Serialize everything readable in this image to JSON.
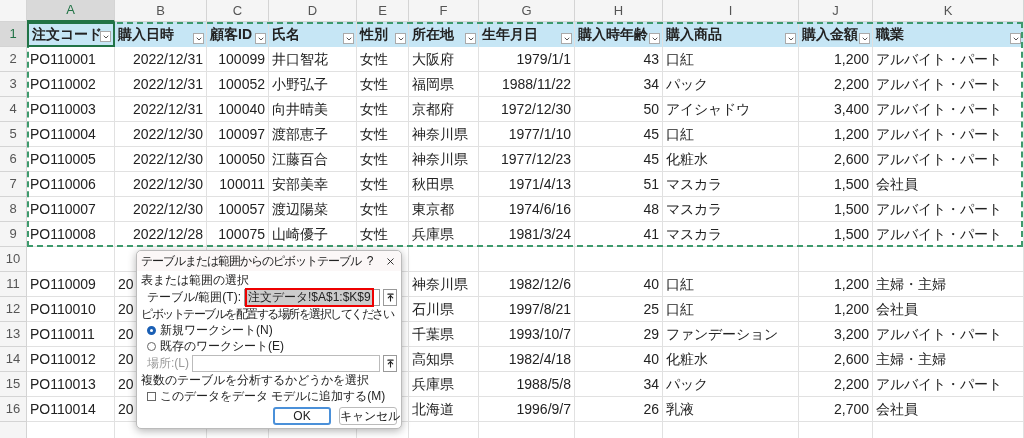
{
  "columns": [
    {
      "letter": "A",
      "selected": true
    },
    {
      "letter": "B",
      "selected": false
    },
    {
      "letter": "C",
      "selected": false
    },
    {
      "letter": "D",
      "selected": false
    },
    {
      "letter": "E",
      "selected": false
    },
    {
      "letter": "F",
      "selected": false
    },
    {
      "letter": "G",
      "selected": false
    },
    {
      "letter": "H",
      "selected": false
    },
    {
      "letter": "I",
      "selected": false
    },
    {
      "letter": "J",
      "selected": false
    },
    {
      "letter": "K",
      "selected": false
    }
  ],
  "copy_marquee": true,
  "header_row": {
    "number": "1",
    "selected": true,
    "cells": [
      {
        "text": "注文コード",
        "selected": true
      },
      {
        "text": "購入日時",
        "selected": false
      },
      {
        "text": "顧客ID",
        "selected": false
      },
      {
        "text": "氏名",
        "selected": false
      },
      {
        "text": "性別",
        "selected": false
      },
      {
        "text": "所在地",
        "selected": false
      },
      {
        "text": "生年月日",
        "selected": false
      },
      {
        "text": "購入時年齢",
        "selected": false
      },
      {
        "text": "購入商品",
        "selected": false
      },
      {
        "text": "購入金額",
        "selected": false
      },
      {
        "text": "職業",
        "selected": false
      }
    ]
  },
  "rows": [
    {
      "number": "2",
      "kind": "full",
      "cells": [
        "PO110001",
        "2022/12/31",
        "100099",
        "井口智花",
        "女性",
        "大阪府",
        "1979/1/1",
        "43",
        "口紅",
        "1,200",
        "アルバイト・パート"
      ]
    },
    {
      "number": "3",
      "kind": "full",
      "cells": [
        "PO110002",
        "2022/12/31",
        "100052",
        "小野弘子",
        "女性",
        "福岡県",
        "1988/11/22",
        "34",
        "パック",
        "2,200",
        "アルバイト・パート"
      ]
    },
    {
      "number": "4",
      "kind": "full",
      "cells": [
        "PO110003",
        "2022/12/31",
        "100040",
        "向井晴美",
        "女性",
        "京都府",
        "1972/12/30",
        "50",
        "アイシャドウ",
        "3,400",
        "アルバイト・パート"
      ]
    },
    {
      "number": "5",
      "kind": "full",
      "cells": [
        "PO110004",
        "2022/12/30",
        "100097",
        "渡部恵子",
        "女性",
        "神奈川県",
        "1977/1/10",
        "45",
        "口紅",
        "1,200",
        "アルバイト・パート"
      ]
    },
    {
      "number": "6",
      "kind": "full",
      "cells": [
        "PO110005",
        "2022/12/30",
        "100050",
        "江藤百合",
        "女性",
        "神奈川県",
        "1977/12/23",
        "45",
        "化粧水",
        "2,600",
        "アルバイト・パート"
      ]
    },
    {
      "number": "7",
      "kind": "full",
      "cells": [
        "PO110006",
        "2022/12/30",
        "100011",
        "安部美幸",
        "女性",
        "秋田県",
        "1971/4/13",
        "51",
        "マスカラ",
        "1,500",
        "会社員"
      ]
    },
    {
      "number": "8",
      "kind": "full",
      "cells": [
        "PO110007",
        "2022/12/30",
        "100057",
        "渡辺陽菜",
        "女性",
        "東京都",
        "1974/6/16",
        "48",
        "マスカラ",
        "1,500",
        "アルバイト・パート"
      ]
    },
    {
      "number": "9",
      "kind": "full",
      "cells": [
        "PO110008",
        "2022/12/28",
        "100075",
        "山崎優子",
        "女性",
        "兵庫県",
        "1981/3/24",
        "41",
        "マスカラ",
        "1,500",
        "アルバイト・パート"
      ]
    },
    {
      "number": "10",
      "kind": "empty"
    },
    {
      "number": "11",
      "kind": "behind_dialog",
      "cells": [
        "PO110009",
        "20",
        null,
        null,
        null,
        "神奈川県",
        "1982/12/6",
        "40",
        "口紅",
        "1,200",
        "主婦・主婦"
      ]
    },
    {
      "number": "12",
      "kind": "behind_dialog",
      "cells": [
        "PO110010",
        "20",
        null,
        null,
        null,
        "石川県",
        "1997/8/21",
        "25",
        "口紅",
        "1,200",
        "会社員"
      ]
    },
    {
      "number": "13",
      "kind": "behind_dialog",
      "cells": [
        "PO110011",
        "20",
        null,
        null,
        null,
        "千葉県",
        "1993/10/7",
        "29",
        "ファンデーション",
        "3,200",
        "アルバイト・パート"
      ]
    },
    {
      "number": "14",
      "kind": "behind_dialog",
      "cells": [
        "PO110012",
        "20",
        null,
        null,
        null,
        "高知県",
        "1982/4/18",
        "40",
        "化粧水",
        "2,600",
        "主婦・主婦"
      ]
    },
    {
      "number": "15",
      "kind": "behind_dialog",
      "cells": [
        "PO110013",
        "20",
        null,
        null,
        null,
        "兵庫県",
        "1988/5/8",
        "34",
        "パック",
        "2,200",
        "アルバイト・パート"
      ]
    },
    {
      "number": "16",
      "kind": "behind_dialog",
      "cells": [
        "PO110014",
        "20",
        null,
        null,
        null,
        "北海道",
        "1996/9/7",
        "26",
        "乳液",
        "2,700",
        "会社員"
      ]
    }
  ],
  "dialog": {
    "title": "テーブルまたは範囲からのピボットテーブル",
    "help": "?",
    "source_section": "表または範囲の選択",
    "range_label": "テーブル/範囲(T):",
    "range_value": "注文データ!$A$1:$K$9",
    "placement_section": "ピボットテーブルを配置する場所を選択してください",
    "radios": [
      {
        "label": "新規ワークシート(N)",
        "selected": true
      },
      {
        "label": "既存のワークシート(E)",
        "selected": false
      }
    ],
    "location_label": "場所:(L)",
    "location_disabled": true,
    "analysis_section": "複数のテーブルを分析するかどうかを選択",
    "checkbox": {
      "label": "このデータをデータ モデルに追加する(M)",
      "checked": false
    },
    "buttons": [
      {
        "label": "OK",
        "default": true
      },
      {
        "label": "キャンセル",
        "default": false
      }
    ]
  }
}
